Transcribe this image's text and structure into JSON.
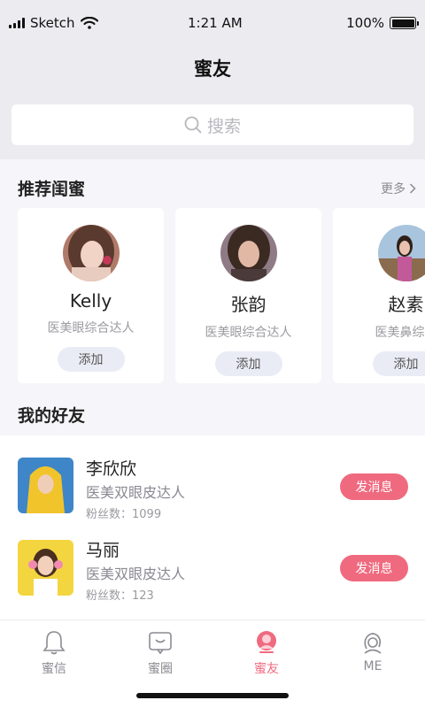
{
  "status_bar": {
    "carrier": "Sketch",
    "time": "1:21 AM",
    "battery": "100%",
    "battery_level": 1.0
  },
  "nav": {
    "title": "蜜友"
  },
  "search": {
    "placeholder": "搜索",
    "icon": "search-icon"
  },
  "recommended": {
    "title": "推荐闺蜜",
    "more_label": "更多",
    "cards": [
      {
        "name": "Kelly",
        "title": "医美眼综合达人",
        "button": "添加"
      },
      {
        "name": "张韵",
        "title": "医美眼综合达人",
        "button": "添加"
      },
      {
        "name": "赵素",
        "title": "医美鼻综合",
        "button": "添加"
      }
    ]
  },
  "friends": {
    "title": "我的好友",
    "items": [
      {
        "name": "李欣欣",
        "title": "医美双眼皮达人",
        "fans": "粉丝数：1099",
        "button": "发消息"
      },
      {
        "name": "马丽",
        "title": "医美双眼皮达人",
        "fans": "粉丝数：123",
        "button": "发消息"
      }
    ]
  },
  "tabs": [
    {
      "label": "蜜信",
      "icon": "bell-icon",
      "active": false
    },
    {
      "label": "蜜圈",
      "icon": "circle-chat-icon",
      "active": false
    },
    {
      "label": "蜜友",
      "icon": "friends-icon",
      "active": true
    },
    {
      "label": "ME",
      "icon": "profile-icon",
      "active": false
    }
  ],
  "colors": {
    "accent": "#f06a7f",
    "background": "#ececf0",
    "panel": "#f6f6fa"
  }
}
